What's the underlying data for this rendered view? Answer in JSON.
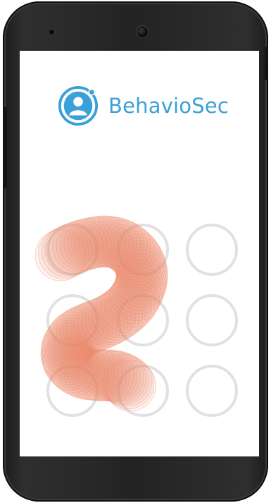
{
  "app": {
    "brand_name": "BehavioSec",
    "brand_color": "#3aa0d8",
    "logo_icon": "user-circle-icon"
  },
  "pattern_lock": {
    "rows": 3,
    "cols": 3,
    "dot_color": "#e1e1e1",
    "trail_color": "#f08a68",
    "drawn_digit_shape": "2"
  }
}
